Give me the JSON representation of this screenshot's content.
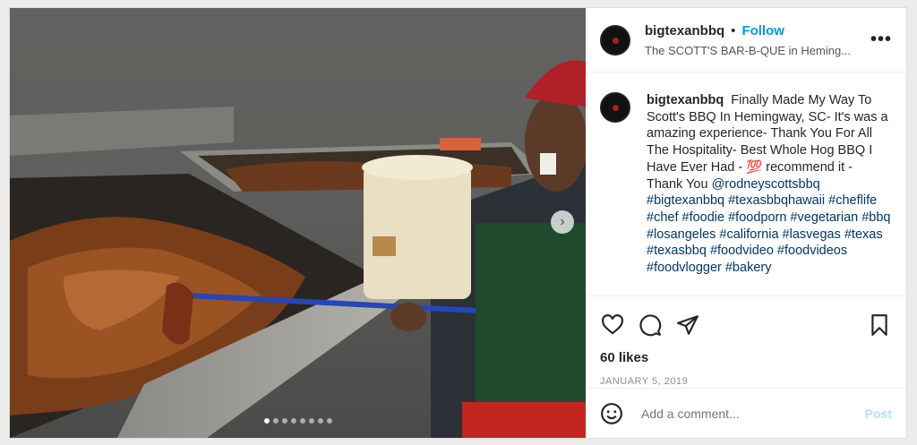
{
  "header": {
    "username": "bigtexanbbq",
    "separator": "•",
    "follow_label": "Follow",
    "location": "The SCOTT'S BAR-B-QUE in Heming...",
    "more_label": "•••"
  },
  "caption": {
    "username": "bigtexanbbq",
    "text": "Finally Made My Way To Scott's BBQ In Hemingway, SC- It's was a amazing experience- Thank You For All The Hospitality- Best Whole Hog BBQ I Have Ever Had - 💯 recommend it - Thank You",
    "mention": "@rodneyscottsbbq",
    "hashtags": "#bigtexanbbq #texasbbqhawaii #cheflife #chef #foodie #foodporn #vegetarian #bbq #losangeles #california #lasvegas #texas #texasbbq #foodvideo #foodvideos #foodvlogger #bakery"
  },
  "media": {
    "next_label": "›",
    "dots_count": 8,
    "active_dot": 0
  },
  "icons": {
    "like": "heart-icon",
    "comment": "comment-icon",
    "share": "share-icon",
    "save": "bookmark-icon",
    "emoji": "smiley-icon"
  },
  "likes": "60 likes",
  "date": "JANUARY 5, 2019",
  "comment": {
    "placeholder": "Add a comment...",
    "post_label": "Post"
  },
  "colors": {
    "follow": "#0095f6",
    "hashtag": "#00376b",
    "post_disabled": "#b2dffc"
  }
}
